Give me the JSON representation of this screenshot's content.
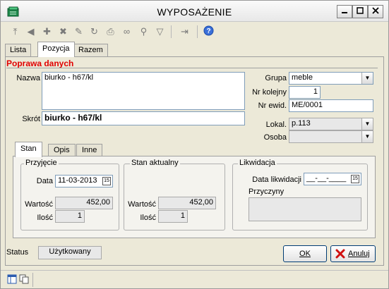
{
  "window": {
    "title": "WYPOSAŻENIE"
  },
  "toolbar": {
    "icons": [
      "first-record-icon",
      "prev-record-icon",
      "add-record-icon",
      "delete-record-icon",
      "edit-record-icon",
      "refresh-icon",
      "print-icon",
      "binoculars-icon",
      "find-next-icon",
      "filter-icon",
      "exit-icon",
      "help-icon"
    ]
  },
  "tabs": [
    "Lista",
    "Pozycja",
    "Razem"
  ],
  "form": {
    "section_title": "Poprawa danych",
    "nazwa_label": "Nazwa",
    "nazwa_value": "biurko - h67/kl",
    "skrot_label": "Skrót",
    "skrot_value": "biurko - h67/kl",
    "grupa_label": "Grupa",
    "grupa_value": "meble",
    "nr_kolejny_label": "Nr kolejny",
    "nr_kolejny_value": "1",
    "nr_ewid_label": "Nr ewid.",
    "nr_ewid_value": "ME/0001",
    "lokal_label": "Lokal.",
    "lokal_value": "p.113",
    "osoba_label": "Osoba",
    "osoba_value": ""
  },
  "subtabs": [
    "Stan",
    "Opis",
    "Inne"
  ],
  "przyjecie": {
    "title": "Przyjęcie",
    "data_label": "Data",
    "data_value": "11-03-2013",
    "wartosc_label": "Wartość",
    "wartosc_value": "452,00",
    "ilosc_label": "Ilość",
    "ilosc_value": "1"
  },
  "stan_aktualny": {
    "title": "Stan aktualny",
    "wartosc_label": "Wartość",
    "wartosc_value": "452,00",
    "ilosc_label": "Ilość",
    "ilosc_value": "1"
  },
  "likwidacja": {
    "title": "Likwidacja",
    "data_label": "Data likwidacji",
    "data_value": "__-__-____",
    "przyczyny_label": "Przyczyny",
    "przyczyny_value": ""
  },
  "calendar_glyph": "15",
  "status": {
    "label": "Status",
    "value": "Użytkowany"
  },
  "buttons": {
    "ok": "OK",
    "cancel": "Anuluj"
  },
  "colors": {
    "section_title": "#e00000",
    "cancel_icon": "#d01010",
    "ok_icon": "#2a8a2a"
  }
}
